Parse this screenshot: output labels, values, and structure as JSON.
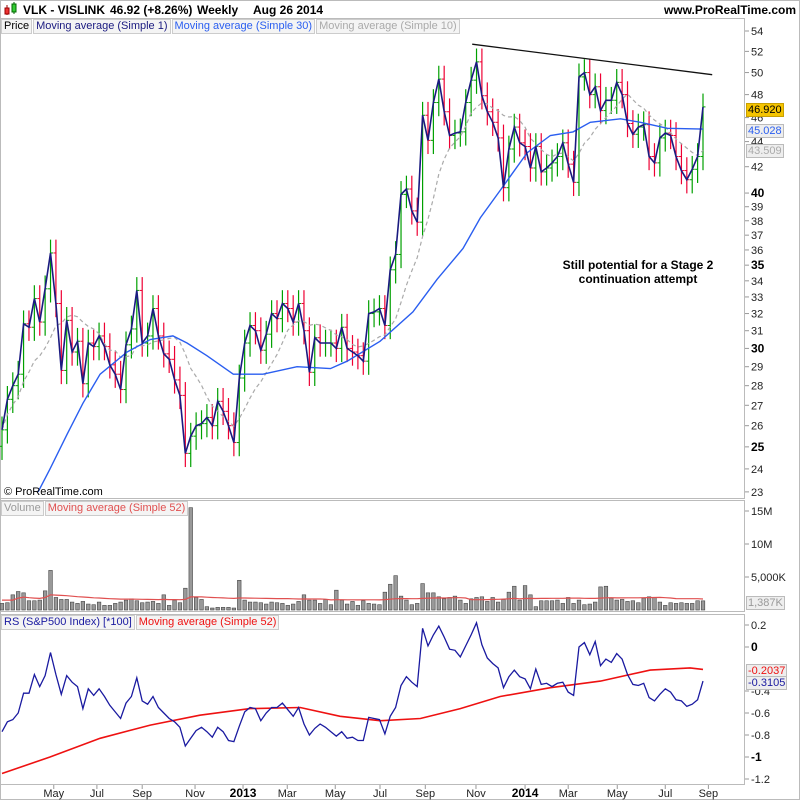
{
  "header": {
    "symbol": "VLK - VISLINK",
    "quote": "46.92 (+8.26%)",
    "period": "Weekly",
    "date": "Aug 26 2014",
    "site": "www.ProRealTime.com"
  },
  "price_legend": {
    "price": "Price",
    "ma1": "Moving average (Simple 1)",
    "ma30": "Moving average (Simple 30)",
    "ma10": "Moving average (Simple 10)"
  },
  "volume_legend": {
    "volume": "Volume",
    "ma52": "Moving average (Simple 52)"
  },
  "rs_legend": {
    "rs": "RS (S&P500 Index) [*100]",
    "ma52": "Moving average (Simple 52)"
  },
  "copyright": "© ProRealTime.com",
  "annotation": {
    "line1": "Still potential for a Stage 2",
    "line2": "continuation attempt"
  },
  "last_values": {
    "price": "46.920",
    "ma30": "45.028",
    "ma10": "43.509",
    "volume": "1,387K",
    "rs_ma52": "-0.2037",
    "rs": "-0.3105"
  },
  "colors": {
    "up": "#00a000",
    "down": "#ee0033",
    "ma1": "#1a1a80",
    "ma30": "#2a5ef0",
    "ma10": "#aaaaaa",
    "volume_bar": "#999999",
    "volume_ma": "#e05050",
    "rs": "#1a1aa0",
    "rs_ma": "#ee1111",
    "price_tag": "#f5c400"
  },
  "chart_data": [
    {
      "type": "line",
      "title": "VLK - VISLINK Weekly",
      "panel": "price",
      "scale": "log",
      "ylim": [
        23,
        54
      ],
      "y_ticks": [
        "23",
        "24",
        "25",
        "26",
        "27",
        "28",
        "29",
        "30",
        "31",
        "32",
        "33",
        "34",
        "35",
        "36",
        "37",
        "38",
        "39",
        "40",
        "42",
        "44",
        "46",
        "48",
        "50",
        "52",
        "54"
      ],
      "y_bold_ticks": [
        "25",
        "30",
        "35",
        "40"
      ],
      "closes": [
        25.8,
        27.3,
        28.0,
        28.6,
        31.4,
        31.2,
        32.9,
        31.5,
        33.5,
        35.8,
        32.6,
        28.8,
        31.6,
        29.8,
        30.4,
        28.1,
        30.3,
        30.1,
        30.7,
        30.1,
        29.1,
        28.6,
        27.8,
        30.2,
        31.1,
        33.4,
        30.3,
        30.7,
        32.3,
        30.7,
        29.7,
        29.4,
        28.3,
        27.5,
        24.7,
        25.5,
        26.0,
        26.1,
        26.4,
        26.0,
        27.2,
        26.7,
        26.0,
        25.2,
        28.4,
        30.3,
        31.3,
        31.0,
        29.9,
        30.8,
        32.0,
        31.7,
        32.6,
        32.3,
        31.5,
        32.6,
        31.0,
        28.7,
        30.6,
        30.3,
        30.3,
        30.3,
        30.0,
        31.2,
        30.0,
        29.8,
        29.6,
        29.3,
        32.0,
        32.1,
        32.3,
        31.3,
        34.7,
        35.7,
        39.9,
        40.3,
        38.7,
        37.9,
        46.2,
        44.1,
        47.3,
        49.4,
        46.5,
        44.5,
        44.7,
        44.8,
        47.3,
        49.3,
        51.0,
        47.9,
        46.5,
        45.6,
        44.3,
        40.4,
        43.4,
        45.2,
        43.9,
        43.6,
        41.9,
        43.6,
        41.6,
        41.9,
        42.3,
        42.8,
        43.9,
        42.2,
        40.8,
        49.6,
        50.0,
        48.0,
        48.7,
        46.6,
        47.5,
        47.5,
        49.1,
        48.0,
        45.5,
        44.6,
        45.2,
        45.4,
        42.8,
        42.3,
        44.3,
        44.7,
        44.5,
        42.8,
        41.7,
        41.0,
        41.8,
        42.8,
        46.92
      ],
      "ma30_samples": [
        [
          6.7,
          23.0
        ],
        [
          8.9,
          24.0
        ],
        [
          12.1,
          25.6
        ],
        [
          15.0,
          27.1
        ],
        [
          18.2,
          28.6
        ],
        [
          23.2,
          29.8
        ],
        [
          27.5,
          30.5
        ],
        [
          31.7,
          30.7
        ],
        [
          34.3,
          30.3
        ],
        [
          38.0,
          29.6
        ],
        [
          42.9,
          28.6
        ],
        [
          46.0,
          28.6
        ],
        [
          48.4,
          28.6
        ],
        [
          54.7,
          29.0
        ],
        [
          60.9,
          28.9
        ],
        [
          64.0,
          29.3
        ],
        [
          70.1,
          30.4
        ],
        [
          76.2,
          32.1
        ],
        [
          80.7,
          34.1
        ],
        [
          85.5,
          36.1
        ],
        [
          88.7,
          38.2
        ],
        [
          92.4,
          40.2
        ],
        [
          97.4,
          43.1
        ],
        [
          101.7,
          44.5
        ],
        [
          105.9,
          44.8
        ],
        [
          109.1,
          45.6
        ],
        [
          114.7,
          45.9
        ],
        [
          118.4,
          45.6
        ],
        [
          123.4,
          45.1
        ],
        [
          130,
          45.028
        ]
      ],
      "trendline": [
        [
          87.2,
          52.7
        ],
        [
          131.7,
          49.8
        ]
      ],
      "x_ticks": [
        {
          "label": "May",
          "week": 9.6,
          "bold": false
        },
        {
          "label": "Jul",
          "week": 17.6,
          "bold": false
        },
        {
          "label": "Sep",
          "week": 26,
          "bold": false
        },
        {
          "label": "Nov",
          "week": 35.8,
          "bold": false
        },
        {
          "label": "2013",
          "week": 44.7,
          "bold": true
        },
        {
          "label": "Mar",
          "week": 52.9,
          "bold": false
        },
        {
          "label": "May",
          "week": 61.8,
          "bold": false
        },
        {
          "label": "Jul",
          "week": 70.1,
          "bold": false
        },
        {
          "label": "Sep",
          "week": 78.5,
          "bold": false
        },
        {
          "label": "Nov",
          "week": 87.9,
          "bold": false
        },
        {
          "label": "2014",
          "week": 97,
          "bold": true
        },
        {
          "label": "Mar",
          "week": 105,
          "bold": false
        },
        {
          "label": "May",
          "week": 114.1,
          "bold": false
        },
        {
          "label": "Jul",
          "week": 123,
          "bold": false
        },
        {
          "label": "Sep",
          "week": 131,
          "bold": false
        }
      ]
    },
    {
      "type": "bar",
      "panel": "volume",
      "ylim": [
        0,
        16
      ],
      "unit": "M",
      "y_ticks": [
        {
          "label": "15M",
          "value": 15
        },
        {
          "label": "10M",
          "value": 10
        },
        {
          "label": "5,000K",
          "value": 5
        }
      ],
      "values": [
        1.0,
        1.1,
        2.3,
        2.8,
        2.6,
        1.4,
        1.4,
        1.5,
        2.9,
        6.0,
        1.9,
        1.6,
        1.6,
        1.2,
        1.0,
        1.3,
        0.9,
        0.8,
        1.2,
        0.7,
        0.7,
        1.0,
        1.2,
        1.5,
        1.7,
        1.4,
        1.1,
        1.2,
        1.3,
        1.0,
        2.3,
        0.7,
        1.5,
        1.1,
        3.3,
        15.5,
        1.9,
        1.6,
        0.5,
        0.3,
        0.4,
        0.4,
        0.4,
        0.3,
        4.5,
        1.5,
        1.2,
        1.2,
        1.1,
        0.9,
        1.2,
        1.1,
        1.0,
        0.7,
        0.9,
        1.3,
        2.3,
        1.5,
        1.5,
        1.0,
        1.6,
        0.8,
        3.0,
        1.5,
        0.9,
        1.3,
        0.7,
        1.4,
        1.0,
        0.9,
        0.8,
        2.7,
        3.9,
        5.2,
        2.1,
        1.5,
        0.8,
        1.0,
        4.0,
        2.6,
        2.6,
        2.0,
        1.7,
        1.9,
        2.1,
        1.5,
        1.0,
        1.7,
        1.9,
        2.0,
        1.3,
        1.9,
        1.2,
        1.6,
        2.7,
        3.6,
        1.5,
        3.7,
        2.3,
        0.5,
        1.4,
        1.4,
        1.4,
        1.5,
        1.0,
        1.9,
        1.0,
        1.5,
        0.8,
        0.9,
        1.2,
        3.5,
        3.6,
        1.8,
        1.5,
        1.6,
        1.3,
        1.4,
        1.1,
        1.8,
        2.0,
        1.9,
        1.2,
        0.7,
        1.1,
        1.0,
        1.1,
        1.0,
        1.0,
        1.4,
        1.387
      ]
    },
    {
      "type": "line",
      "panel": "rs",
      "ylim": [
        -1.3,
        0.3
      ],
      "y_ticks": [
        {
          "label": "0.2",
          "value": 0.2,
          "bold": false
        },
        {
          "label": "0",
          "value": 0,
          "bold": true
        },
        {
          "label": "-0.4",
          "value": -0.4,
          "bold": false
        },
        {
          "label": "-0.6",
          "value": -0.6,
          "bold": false
        },
        {
          "label": "-0.8",
          "value": -0.8,
          "bold": false
        },
        {
          "label": "-1",
          "value": -1,
          "bold": true
        },
        {
          "label": "-1.2",
          "value": -1.2,
          "bold": false
        }
      ],
      "rs": [
        -0.77,
        -0.68,
        -0.66,
        -0.6,
        -0.42,
        -0.42,
        -0.25,
        -0.36,
        -0.26,
        -0.05,
        -0.25,
        -0.43,
        -0.26,
        -0.32,
        -0.36,
        -0.56,
        -0.38,
        -0.44,
        -0.38,
        -0.45,
        -0.53,
        -0.59,
        -0.65,
        -0.51,
        -0.45,
        -0.28,
        -0.49,
        -0.52,
        -0.45,
        -0.55,
        -0.6,
        -0.65,
        -0.68,
        -0.73,
        -0.9,
        -0.83,
        -0.76,
        -0.73,
        -0.77,
        -0.82,
        -0.73,
        -0.77,
        -0.85,
        -0.86,
        -0.72,
        -0.59,
        -0.55,
        -0.56,
        -0.67,
        -0.6,
        -0.55,
        -0.55,
        -0.51,
        -0.57,
        -0.63,
        -0.55,
        -0.7,
        -0.8,
        -0.74,
        -0.7,
        -0.73,
        -0.77,
        -0.81,
        -0.77,
        -0.83,
        -0.82,
        -0.85,
        -0.85,
        -0.64,
        -0.65,
        -0.66,
        -0.79,
        -0.63,
        -0.55,
        -0.35,
        -0.27,
        -0.32,
        -0.36,
        0.17,
        0.01,
        0.11,
        0.19,
        0.09,
        -0.02,
        -0.03,
        -0.09,
        0.01,
        0.11,
        0.22,
        0.02,
        -0.1,
        -0.15,
        -0.19,
        -0.37,
        -0.27,
        -0.21,
        -0.27,
        -0.29,
        -0.38,
        -0.2,
        -0.34,
        -0.33,
        -0.36,
        -0.33,
        -0.32,
        -0.41,
        -0.44,
        0.0,
        0.04,
        -0.07,
        0.05,
        -0.17,
        -0.11,
        -0.14,
        -0.06,
        -0.11,
        -0.25,
        -0.34,
        -0.35,
        -0.33,
        -0.46,
        -0.49,
        -0.43,
        -0.38,
        -0.41,
        -0.48,
        -0.49,
        -0.54,
        -0.52,
        -0.48,
        -0.31
      ],
      "rs_ma52_samples": [
        [
          0,
          -1.15
        ],
        [
          8.9,
          -1.0
        ],
        [
          18.2,
          -0.83
        ],
        [
          27.5,
          -0.71
        ],
        [
          36.7,
          -0.62
        ],
        [
          46.0,
          -0.56
        ],
        [
          55.3,
          -0.55
        ],
        [
          62.7,
          -0.63
        ],
        [
          70.1,
          -0.67
        ],
        [
          77.6,
          -0.65
        ],
        [
          85.0,
          -0.56
        ],
        [
          92.4,
          -0.45
        ],
        [
          101.7,
          -0.37
        ],
        [
          111.0,
          -0.31
        ],
        [
          120.2,
          -0.21
        ],
        [
          127.6,
          -0.19
        ],
        [
          130,
          -0.2037
        ]
      ]
    }
  ]
}
